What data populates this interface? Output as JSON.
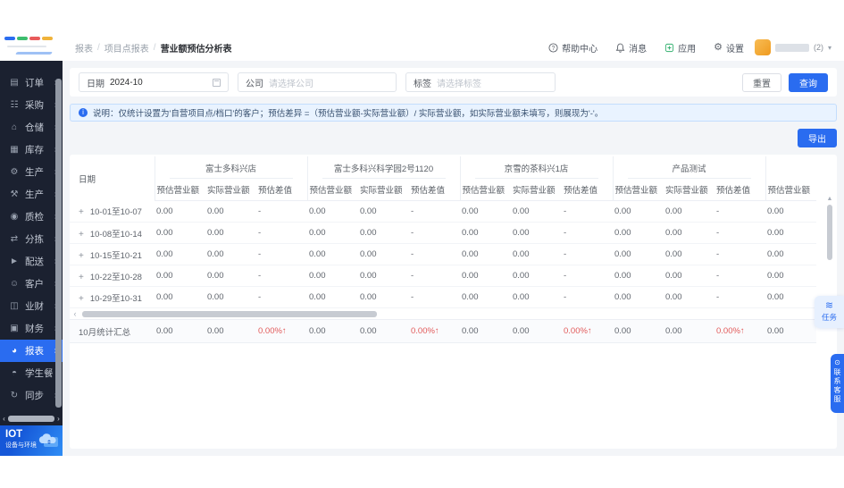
{
  "topbar": {
    "breadcrumb": [
      "报表",
      "项目点报表",
      "营业额预估分析表"
    ],
    "actions": [
      {
        "label": "帮助中心",
        "icon": "question-circle-icon"
      },
      {
        "label": "消息",
        "icon": "bell-icon"
      },
      {
        "label": "应用",
        "icon": "apps-icon"
      },
      {
        "label": "设置",
        "icon": "gear-icon"
      }
    ],
    "user": {
      "badge": "(2)"
    }
  },
  "sidebar": {
    "items": [
      {
        "key": "orders",
        "label": "订单",
        "icon": "orders-icon",
        "glyph": "▤",
        "arrow": true,
        "active": false
      },
      {
        "key": "procurement",
        "label": "采购",
        "icon": "procurement-icon",
        "glyph": "☷",
        "arrow": true,
        "active": false
      },
      {
        "key": "warehouse",
        "label": "仓储",
        "icon": "warehouse-icon",
        "glyph": "⌂",
        "arrow": true,
        "active": false
      },
      {
        "key": "inventory",
        "label": "库存",
        "icon": "inventory-icon",
        "glyph": "▦",
        "arrow": true,
        "active": false
      },
      {
        "key": "production-1",
        "label": "生产",
        "icon": "production-icon",
        "glyph": "⚙",
        "arrow": true,
        "active": false
      },
      {
        "key": "production-2",
        "label": "生产",
        "icon": "production2-icon",
        "glyph": "⚒",
        "arrow": true,
        "active": false
      },
      {
        "key": "quality",
        "label": "质检",
        "icon": "quality-icon",
        "glyph": "◉",
        "arrow": true,
        "active": false
      },
      {
        "key": "sorting",
        "label": "分拣",
        "icon": "sorting-icon",
        "glyph": "⇄",
        "arrow": true,
        "active": false
      },
      {
        "key": "delivery",
        "label": "配送",
        "icon": "delivery-icon",
        "glyph": "►",
        "arrow": true,
        "active": false
      },
      {
        "key": "customers",
        "label": "客户",
        "icon": "customers-icon",
        "glyph": "☺",
        "arrow": true,
        "active": false
      },
      {
        "key": "biz-finance",
        "label": "业财",
        "icon": "biz-finance-icon",
        "glyph": "◫",
        "arrow": true,
        "active": false
      },
      {
        "key": "finance",
        "label": "财务",
        "icon": "finance-icon",
        "glyph": "▣",
        "arrow": true,
        "active": false
      },
      {
        "key": "reports",
        "label": "报表",
        "icon": "reports-icon",
        "glyph": "◕",
        "arrow": true,
        "active": true
      },
      {
        "key": "student-meal",
        "label": "学生餐",
        "icon": "student-meal-icon",
        "glyph": "◓",
        "arrow": false,
        "active": false
      },
      {
        "key": "sync",
        "label": "同步",
        "icon": "sync-icon",
        "glyph": "↻",
        "arrow": true,
        "active": false
      }
    ],
    "iot": {
      "title": "IOT",
      "subtitle": "设备与环境"
    }
  },
  "filters": {
    "date": {
      "label": "日期",
      "value": "2024-10"
    },
    "company": {
      "label": "公司",
      "placeholder": "请选择公司"
    },
    "tag": {
      "label": "标签",
      "placeholder": "请选择标签"
    },
    "reset_label": "重置",
    "search_label": "查询"
  },
  "notice": {
    "text": "说明：仅统计设置为'自营项目点/档口'的客户；预估差异 =（预估营业额-实际营业额）/ 实际营业额，如实际营业额未填写，则展现为'-'。"
  },
  "toolbar": {
    "export_label": "导出"
  },
  "table": {
    "date_col": "日期",
    "groups": [
      "富士多科兴店",
      "富士多科兴科学园2号1120",
      "京雪的茶科兴1店",
      "产品测试"
    ],
    "sub_cols": [
      "预估营业额",
      "实际营业额",
      "预估差值"
    ],
    "partial_col": "预估营业额",
    "rows": [
      {
        "label": "10-01至10-07",
        "values": [
          "0.00",
          "0.00",
          "-",
          "0.00",
          "0.00",
          "-",
          "0.00",
          "0.00",
          "-",
          "0.00",
          "0.00",
          "-",
          "0.00"
        ]
      },
      {
        "label": "10-08至10-14",
        "values": [
          "0.00",
          "0.00",
          "-",
          "0.00",
          "0.00",
          "-",
          "0.00",
          "0.00",
          "-",
          "0.00",
          "0.00",
          "-",
          "0.00"
        ]
      },
      {
        "label": "10-15至10-21",
        "values": [
          "0.00",
          "0.00",
          "-",
          "0.00",
          "0.00",
          "-",
          "0.00",
          "0.00",
          "-",
          "0.00",
          "0.00",
          "-",
          "0.00"
        ]
      },
      {
        "label": "10-22至10-28",
        "values": [
          "0.00",
          "0.00",
          "-",
          "0.00",
          "0.00",
          "-",
          "0.00",
          "0.00",
          "-",
          "0.00",
          "0.00",
          "-",
          "0.00"
        ]
      },
      {
        "label": "10-29至10-31",
        "values": [
          "0.00",
          "0.00",
          "-",
          "0.00",
          "0.00",
          "-",
          "0.00",
          "0.00",
          "-",
          "0.00",
          "0.00",
          "-",
          "0.00"
        ]
      }
    ],
    "summary": {
      "label": "10月统计汇总",
      "values": [
        "0.00",
        "0.00",
        "0.00%↑",
        "0.00",
        "0.00",
        "0.00%↑",
        "0.00",
        "0.00",
        "0.00%↑",
        "0.00",
        "0.00",
        "0.00%↑",
        "0.00"
      ]
    }
  },
  "floating": {
    "tasks_label": "任务",
    "service_label": "联系客服"
  },
  "icons": {
    "tasks_glyph": "≋",
    "service_glyph": "⊙",
    "gear_glyph": "⚙"
  },
  "colors": {
    "accent": "#2a6cf0",
    "sidebar_bg": "#1b2130",
    "danger": "#e25a5a",
    "notice_bg": "#e9f3ff"
  }
}
